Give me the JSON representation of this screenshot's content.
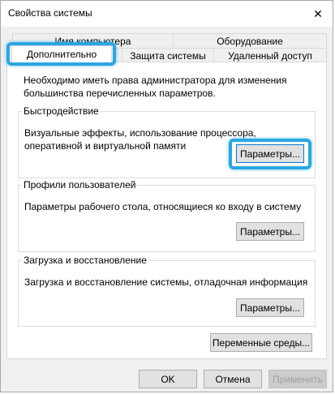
{
  "window": {
    "title": "Свойства системы",
    "close_glyph": "✕"
  },
  "tabs": {
    "row1": [
      "Имя компьютера",
      "Оборудование"
    ],
    "row2": [
      "Дополнительно",
      "Защита системы",
      "Удаленный доступ"
    ],
    "selected": "Дополнительно"
  },
  "advanced": {
    "intro": "Необходимо иметь права администратора для изменения большинства перечисленных параметров.",
    "performance": {
      "title": "Быстродействие",
      "description": "Визуальные эффекты, использование процессора, оперативной и виртуальной памяти",
      "button": "Параметры..."
    },
    "profiles": {
      "title": "Профили пользователей",
      "description": "Параметры рабочего стола, относящиеся ко входу в систему",
      "button": "Параметры..."
    },
    "startup": {
      "title": "Загрузка и восстановление",
      "description": "Загрузка и восстановление системы, отладочная информация",
      "button": "Параметры..."
    },
    "env_button": "Переменные среды..."
  },
  "footer": {
    "ok": "OK",
    "cancel": "Отмена",
    "apply": "Применить"
  },
  "colors": {
    "highlight": "#2aa7e3",
    "window_bg": "#f0f0f0",
    "panel_bg": "#ffffff"
  }
}
